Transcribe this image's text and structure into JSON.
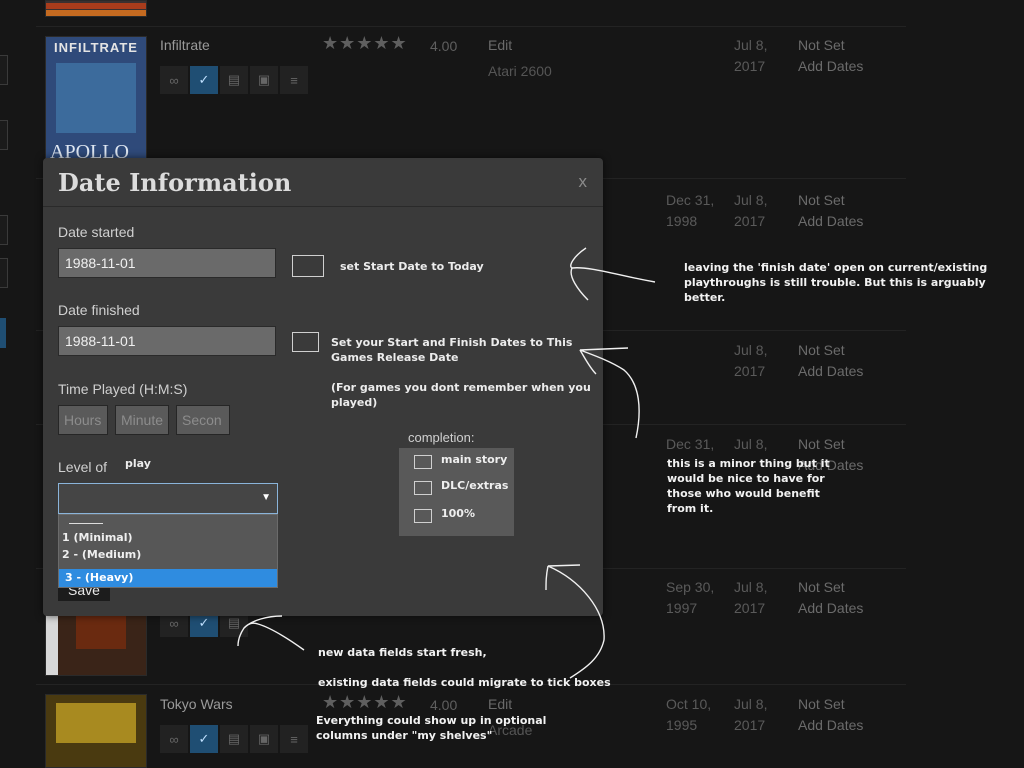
{
  "games": [
    {
      "title": "Infiltrate",
      "rating": "4.00",
      "edit": "Edit",
      "platform": "Atari 2600",
      "release_date": [
        "",
        ""
      ],
      "added_date": [
        "Jul 8,",
        "2017"
      ],
      "finish": "Not Set",
      "add_dates": "Add Dates",
      "cover_text": "INFILTRATE"
    },
    {
      "title": "",
      "rating": "",
      "edit": "",
      "platform": "",
      "release_date": [
        "Dec 31,",
        "1998"
      ],
      "added_date": [
        "Jul 8,",
        "2017"
      ],
      "finish": "Not Set",
      "add_dates": "Add Dates"
    },
    {
      "title": "",
      "rating": "",
      "edit": "",
      "platform": "",
      "release_date": [
        "",
        ""
      ],
      "added_date": [
        "Jul 8,",
        "2017"
      ],
      "finish": "Not Set",
      "add_dates": "Add Dates"
    },
    {
      "title": "",
      "rating": "",
      "edit": "",
      "platform": "",
      "release_date": [
        "Dec 31,",
        ""
      ],
      "added_date": [
        "Jul 8,",
        ""
      ],
      "finish": "Not Set",
      "add_dates": "Add Dates"
    },
    {
      "title": "",
      "rating": "",
      "edit": "",
      "platform": "",
      "release_date": [
        "Sep 30,",
        "1997"
      ],
      "added_date": [
        "Jul 8,",
        "2017"
      ],
      "finish": "Not Set",
      "add_dates": "Add Dates"
    },
    {
      "title": "Tokyo Wars",
      "rating": "4.00",
      "edit": "Edit",
      "platform": "Arcade",
      "release_date": [
        "Oct 10,",
        "1995"
      ],
      "added_date": [
        "Jul 8,",
        "2017"
      ],
      "finish": "Not Set",
      "add_dates": "Add Dates"
    }
  ],
  "modal": {
    "title": "Date Information",
    "close": "x",
    "date_started_label": "Date started",
    "date_started_value": "1988-11-01",
    "date_finished_label": "Date finished",
    "date_finished_value": "1988-11-01",
    "start_today_note": "set Start Date to Today",
    "release_date_note_1": "Set your Start and Finish Dates to This",
    "release_date_note_2": "Games Release Date",
    "forgot_note_1": "(For games you dont remember when you",
    "forgot_note_2": "played)",
    "time_played_label": "Time Played (H:M:S)",
    "hours_placeholder": "Hours",
    "minutes_placeholder": "Minute",
    "seconds_placeholder": "Secon",
    "level_label": "Level of",
    "level_label_extra": "play",
    "level_options": [
      "1 (Minimal)",
      "2 - (Medium)"
    ],
    "level_selected": "3 - (Heavy)",
    "save_label": "Save",
    "completion_label": "completion:",
    "completion_options": [
      "main story",
      "DLC/extras",
      "100%"
    ]
  },
  "annotations": {
    "finish_date_1": "leaving the 'finish date' open on current/existing",
    "finish_date_2": "playthroughs is still trouble. But this is arguably better.",
    "minor_1": "this is a minor thing but it",
    "minor_2": "would be nice to have for",
    "minor_3": "those who would benefit",
    "minor_4": "from it.",
    "fresh": "new data fields start fresh,",
    "migrate": "existing data fields could migrate to tick boxes",
    "shelves_1": "Everything could show up in optional",
    "shelves_2": "columns under \"my shelves\""
  },
  "colors": {
    "accent": "#2f8ce0",
    "modal_bg": "#3a3a3a",
    "page_bg": "#161616"
  }
}
